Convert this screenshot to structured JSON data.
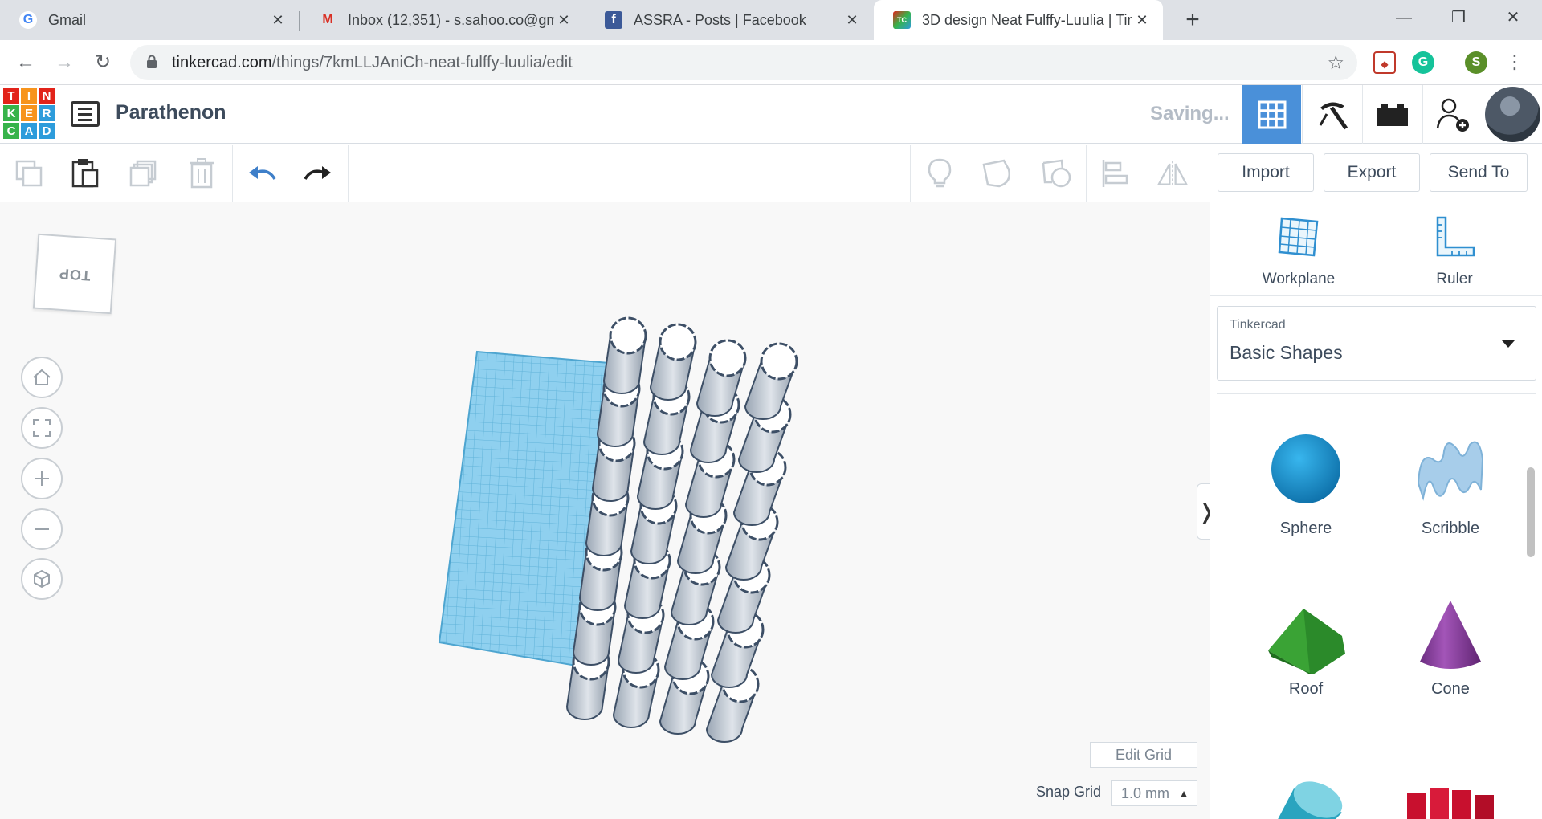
{
  "browser": {
    "tabs": [
      {
        "title": "Gmail",
        "favicon": "G"
      },
      {
        "title": "Inbox (12,351) - s.sahoo.co@gma",
        "favicon": "M"
      },
      {
        "title": "ASSRA - Posts | Facebook",
        "favicon": "f"
      },
      {
        "title": "3D design Neat Fulffy-Luulia | Tin",
        "favicon": "TC"
      }
    ],
    "url_host": "tinkercad.com",
    "url_path": "/things/7kmLLJAniCh-neat-fulffy-luulia/edit",
    "profile_initial": "S"
  },
  "app": {
    "logo_letters": [
      "T",
      "I",
      "N",
      "K",
      "E",
      "R",
      "C",
      "A",
      "D"
    ],
    "logo_colors": [
      "#e2231a",
      "#f7941d",
      "#e2231a",
      "#37b34a",
      "#f7941d",
      "#2d9cdb",
      "#37b34a",
      "#2d9cdb",
      "#2d9cdb"
    ],
    "design_title": "Parathenon",
    "status": "Saving...",
    "accent": "#4a90d9"
  },
  "toolbar": {
    "import_label": "Import",
    "export_label": "Export",
    "sendto_label": "Send To"
  },
  "canvas": {
    "viewcube_label": "TOP",
    "edit_grid_label": "Edit Grid",
    "snap_grid_label": "Snap Grid",
    "snap_grid_value": "1.0 mm"
  },
  "panel": {
    "workplane_label": "Workplane",
    "ruler_label": "Ruler",
    "library_small": "Tinkercad",
    "library_name": "Basic Shapes",
    "shapes": [
      {
        "name": "Sphere",
        "color": "#1a9bd7"
      },
      {
        "name": "Scribble",
        "color": "#8fbfe0"
      },
      {
        "name": "Roof",
        "color": "#3aa335"
      },
      {
        "name": "Cone",
        "color": "#8a3d9c"
      }
    ]
  }
}
